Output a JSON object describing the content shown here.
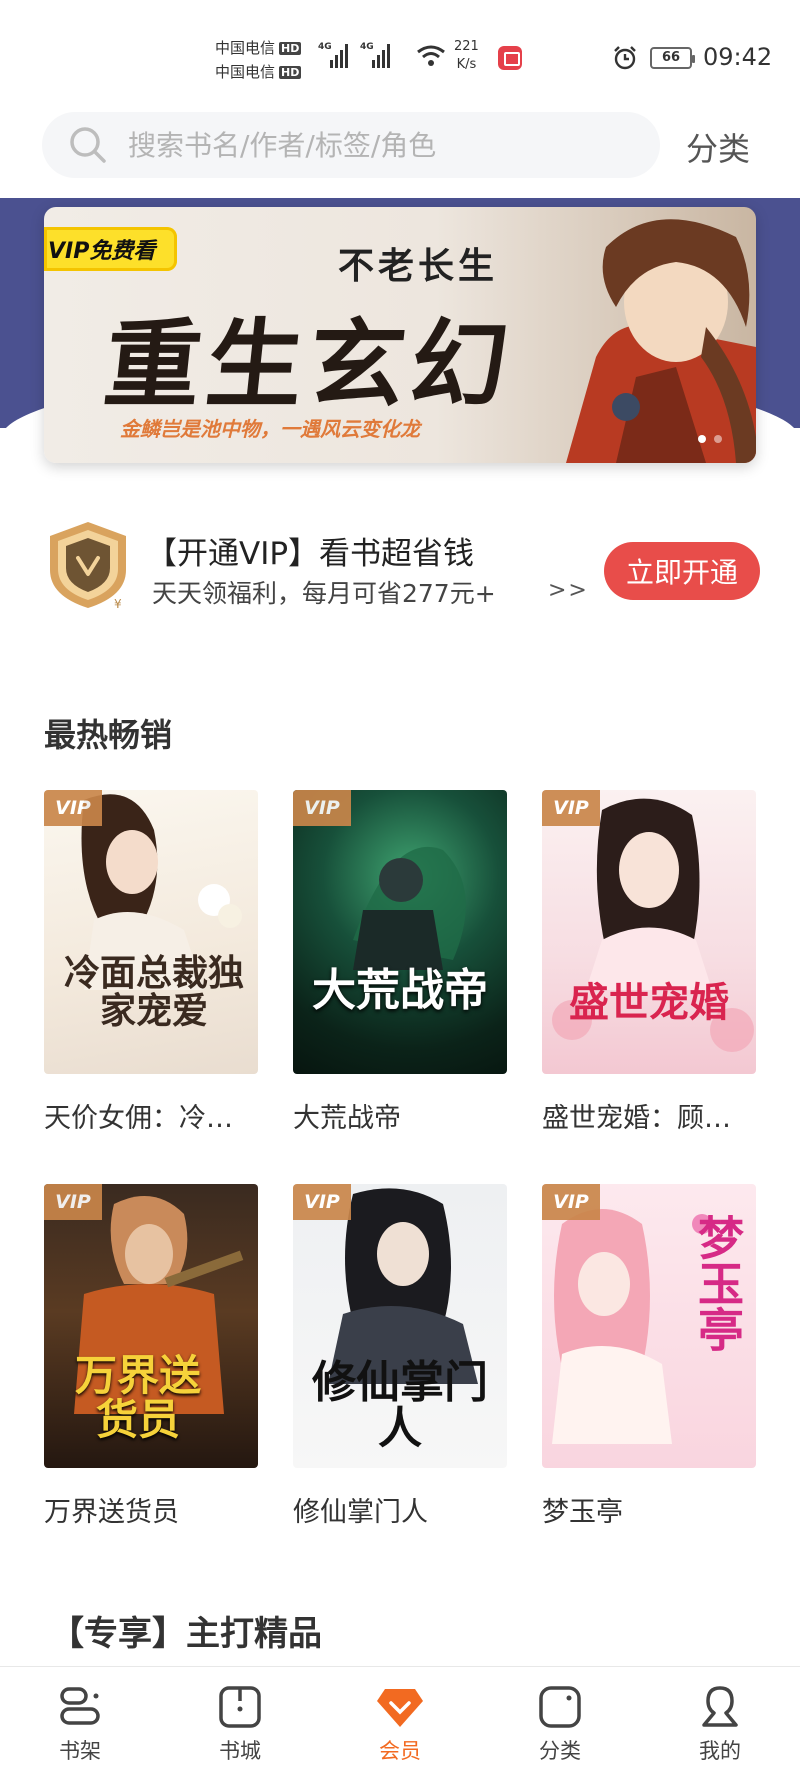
{
  "status_bar": {
    "carrier_1": "中国电信",
    "carrier_2": "中国电信",
    "hd": "HD",
    "network_1": "4G",
    "network_2": "4G",
    "speed_value": "221",
    "speed_unit": "K/s",
    "battery": "66",
    "time": "09:42"
  },
  "search": {
    "placeholder": "搜索书名/作者/标签/角色",
    "category_label": "分类"
  },
  "banner": {
    "tag": "VIP免费看",
    "subtitle": "不老长生",
    "title": "重生玄幻",
    "slogan": "金鳞岂是池中物，一遇风云变化龙"
  },
  "vip_promo": {
    "title": "【开通VIP】看书超省钱",
    "description": "天天领福利，每月可省277元+",
    "arrow": ">>",
    "button_label": "立即开通"
  },
  "hot_section": {
    "title": "最热畅销",
    "vip_tag": "VIP",
    "books": [
      {
        "name": "天价女佣：冷面总裁独家宠爱",
        "cover_title": "冷面总裁独家宠爱"
      },
      {
        "name": "大荒战帝",
        "cover_title": "大荒战帝"
      },
      {
        "name": "盛世宠婚：顾少的娇蛮小妻",
        "cover_title": "盛世宠婚"
      },
      {
        "name": "万界送货员",
        "cover_title": "万界送货员"
      },
      {
        "name": "修仙掌门人",
        "cover_title": "修仙掌门人"
      },
      {
        "name": "梦玉亭",
        "cover_title": "梦玉亭"
      }
    ]
  },
  "exclusive_section": {
    "title": "【专享】主打精品"
  },
  "bottom_nav": {
    "items": [
      {
        "label": "书架",
        "icon": "bookshelf-icon"
      },
      {
        "label": "书城",
        "icon": "bookstore-icon"
      },
      {
        "label": "会员",
        "icon": "membership-diamond-icon"
      },
      {
        "label": "分类",
        "icon": "category-icon"
      },
      {
        "label": "我的",
        "icon": "profile-icon"
      }
    ],
    "active_index": 2
  },
  "colors": {
    "accent": "#f26a21",
    "vip_button": "#e84d4a",
    "banner_bg": "#4b5190"
  }
}
